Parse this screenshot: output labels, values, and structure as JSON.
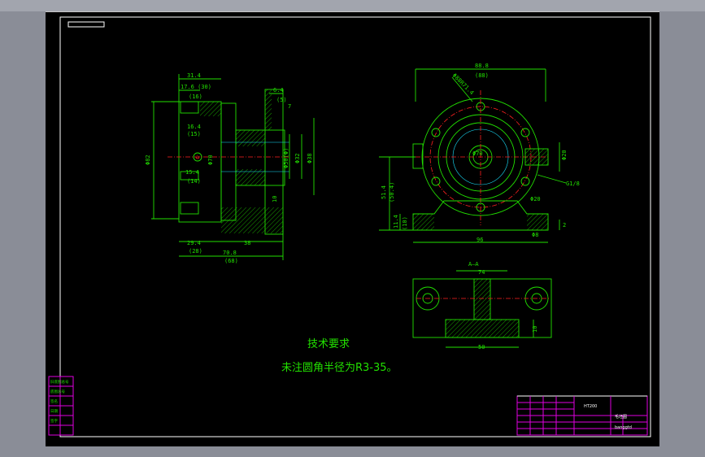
{
  "drawing": {
    "side_view": {
      "dim_top_overall": "31.4",
      "dim_top_overall_alt": "17.6 (30)",
      "dim_thread_top": "(16)",
      "dim_inner_a": "16.4",
      "dim_inner_a_alt": "(15)",
      "dim_inner_b": "15.4",
      "dim_inner_b_alt": "(14)",
      "dim_height": "Φ82",
      "dim_flange_w": "6.4",
      "dim_flange_w_alt": "(5)",
      "dim_bore_1": "Φ32",
      "dim_bore_2": "Φ38",
      "dim_bore_3": "Φ50(Φ)",
      "dim_bore_4": "Φ70",
      "dim_small": "7",
      "dim_bot_a": "29.4",
      "dim_bot_a_alt": "(28)",
      "dim_bot_b": "38",
      "dim_bot_total": "70.8",
      "dim_bot_total_alt": "(68)",
      "dim_angle": "10"
    },
    "front_view": {
      "dim_top": "88.8",
      "dim_top_alt": "(88)",
      "dim_pcd": "Φ88R71.4",
      "dim_center_bore": "Φ70",
      "dim_right_a": "Φ20",
      "dim_thread": "G1/8",
      "dim_center_height": "51.4",
      "dim_center_height_alt": "(50.4)",
      "dim_base_h": "11.4",
      "dim_base_h_alt": "(10)",
      "dim_hole": "Φ20",
      "dim_slot": "Φ8",
      "dim_base_w": "96",
      "dim_foot_h": "2"
    },
    "section_view": {
      "label": "A—A",
      "dim_top": "74",
      "dim_bottom": "50",
      "dim_rib": "10"
    },
    "notes": {
      "heading": "技术要求",
      "line1": "未注圆角半径为R3-35。"
    }
  },
  "title_block": {
    "part_name": "毛坯图",
    "material": "HT200",
    "code": "banggtd"
  },
  "revision_block": {
    "rows": [
      "旧底图总号",
      "底图总号",
      "签名",
      "日期",
      "签字"
    ]
  },
  "colors": {
    "background": "#000000",
    "frame": "#ffffff",
    "outline": "#22e000",
    "centerline": "#ff2020",
    "hidden": "#19e3ff",
    "table": "#e000e0"
  }
}
